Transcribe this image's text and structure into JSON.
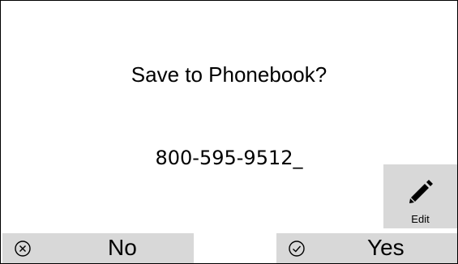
{
  "dialog": {
    "title": "Save to Phonebook?",
    "number": "800-595-9512_"
  },
  "edit": {
    "label": "Edit",
    "icon": "pencil-icon"
  },
  "buttons": {
    "no_label": "No",
    "no_icon": "circle-x-icon",
    "yes_label": "Yes",
    "yes_icon": "circle-check-icon"
  },
  "colors": {
    "button_bg": "#d8d8d8",
    "text": "#000000",
    "background": "#ffffff"
  }
}
